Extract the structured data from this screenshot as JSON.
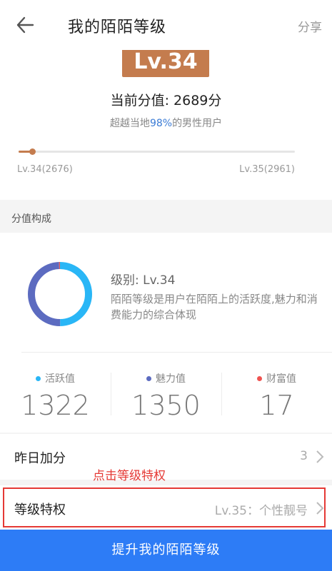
{
  "header": {
    "title": "我的陌陌等级",
    "share_label": "分享"
  },
  "level": {
    "badge": "Lv.34",
    "current_score_text": "当前分值: 2689分",
    "beat_prefix": "超越当地",
    "beat_percent": "98%",
    "beat_suffix": "的男性用户",
    "progress_fraction": 0.05,
    "left_tick": "Lv.34(2676)",
    "right_tick": "Lv.35(2961)"
  },
  "composition": {
    "section_title": "分值构成",
    "level_line": "级别: Lv.34",
    "description": "陌陌等级是用户在陌陌上的活跃度,魅力和消费能力的综合体现",
    "stats": [
      {
        "label": "活跃值",
        "value": "1322",
        "color": "#29b6f6"
      },
      {
        "label": "魅力值",
        "value": "1350",
        "color": "#5c6bc0"
      },
      {
        "label": "财富值",
        "value": "17",
        "color": "#ef5350"
      }
    ]
  },
  "yesterday": {
    "label": "昨日加分",
    "value": "3"
  },
  "annotation": "点击等级特权",
  "privilege": {
    "label": "等级特权",
    "value": "Lv.35：个性靓号"
  },
  "cta_label": "提升我的陌陌等级"
}
